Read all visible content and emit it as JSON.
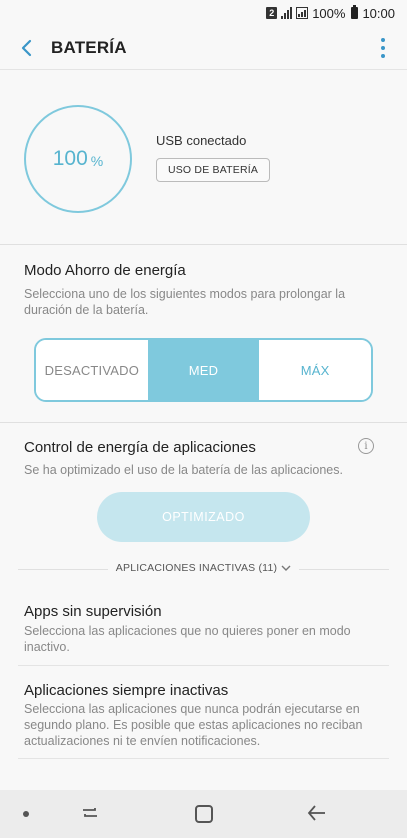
{
  "status_bar": {
    "sim_number": "2",
    "battery_percent": "100%",
    "time": "10:00"
  },
  "app_bar": {
    "title": "BATERÍA"
  },
  "battery": {
    "level": "100",
    "unit": "%",
    "charging_status": "USB conectado",
    "usage_button_label": "USO DE BATERÍA"
  },
  "power_saving": {
    "title": "Modo Ahorro de energía",
    "description": "Selecciona uno de los siguientes modos para prolongar la duración de la batería.",
    "options": [
      "DESACTIVADO",
      "MED",
      "MÁX"
    ],
    "selected": "MED"
  },
  "app_power": {
    "title": "Control de energía de aplicaciones",
    "description": "Se ha optimizado el uso de la batería de las aplicaciones.",
    "button_label": "OPTIMIZADO",
    "inactive_apps_label": "APLICACIONES INACTIVAS (11)"
  },
  "list": [
    {
      "title": "Apps sin supervisión",
      "description": "Selecciona las aplicaciones que no quieres poner en modo inactivo."
    },
    {
      "title": "Aplicaciones siempre inactivas",
      "description": "Selecciona las aplicaciones que nunca podrán ejecutarse en segundo plano. Es posible que estas aplicaciones no reciban actualizaciones ni te envíen notificaciones."
    }
  ],
  "colors": {
    "accent": "#7fc9dd",
    "accent_text": "#57b4cf",
    "icon_blue": "#3a96c8"
  }
}
